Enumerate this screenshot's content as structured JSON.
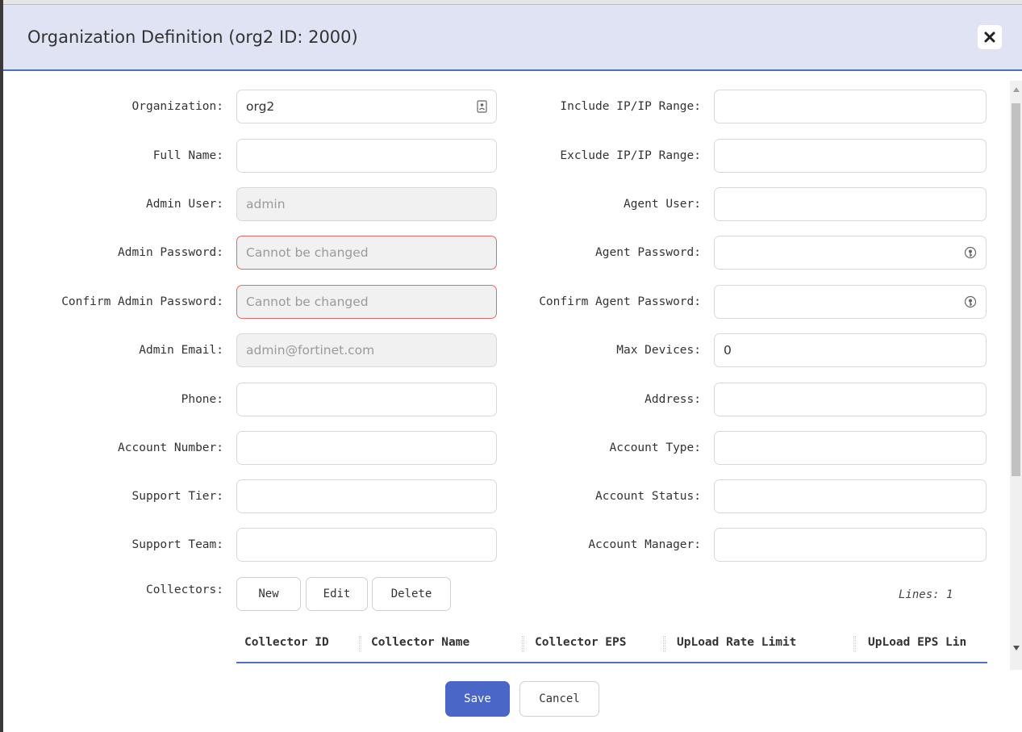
{
  "dialog": {
    "title": "Organization Definition (org2 ID: 2000)",
    "close_icon": "close-icon"
  },
  "left_fields": [
    {
      "label": "Organization:",
      "value": "org2",
      "placeholder": "",
      "state": "normal",
      "icon": "contact-card-icon"
    },
    {
      "label": "Full Name:",
      "value": "",
      "placeholder": "",
      "state": "normal"
    },
    {
      "label": "Admin User:",
      "value": "admin",
      "placeholder": "",
      "state": "disabled"
    },
    {
      "label": "Admin Password:",
      "value": "",
      "placeholder": "Cannot be changed",
      "state": "error"
    },
    {
      "label": "Confirm Admin Password:",
      "value": "",
      "placeholder": "Cannot be changed",
      "state": "error"
    },
    {
      "label": "Admin Email:",
      "value": "admin@fortinet.com",
      "placeholder": "",
      "state": "disabled"
    },
    {
      "label": "Phone:",
      "value": "",
      "placeholder": "",
      "state": "normal"
    },
    {
      "label": "Account Number:",
      "value": "",
      "placeholder": "",
      "state": "normal"
    },
    {
      "label": "Support Tier:",
      "value": "",
      "placeholder": "",
      "state": "normal"
    },
    {
      "label": "Support Team:",
      "value": "",
      "placeholder": "",
      "state": "normal"
    }
  ],
  "right_fields": [
    {
      "label": "Include IP/IP Range:",
      "value": "",
      "placeholder": "",
      "state": "normal"
    },
    {
      "label": "Exclude IP/IP Range:",
      "value": "",
      "placeholder": "",
      "state": "normal"
    },
    {
      "label": "Agent User:",
      "value": "",
      "placeholder": "",
      "state": "normal"
    },
    {
      "label": "Agent Password:",
      "value": "",
      "placeholder": "",
      "state": "normal",
      "icon": "password-key-icon"
    },
    {
      "label": "Confirm Agent Password:",
      "value": "",
      "placeholder": "",
      "state": "normal",
      "icon": "password-key-icon"
    },
    {
      "label": "Max Devices:",
      "value": "0",
      "placeholder": "",
      "state": "normal"
    },
    {
      "label": "Address:",
      "value": "",
      "placeholder": "",
      "state": "normal"
    },
    {
      "label": "Account Type:",
      "value": "",
      "placeholder": "",
      "state": "normal"
    },
    {
      "label": "Account Status:",
      "value": "",
      "placeholder": "",
      "state": "normal"
    },
    {
      "label": "Account Manager:",
      "value": "",
      "placeholder": "",
      "state": "normal"
    }
  ],
  "collectors": {
    "label": "Collectors:",
    "buttons": {
      "new": "New",
      "edit": "Edit",
      "delete": "Delete"
    },
    "lines": "Lines: 1",
    "columns": [
      "Collector ID",
      "Collector Name",
      "Collector EPS",
      "UpLoad Rate Limit",
      "UpLoad EPS Lin"
    ]
  },
  "footer": {
    "save": "Save",
    "cancel": "Cancel"
  },
  "colors": {
    "header_bg": "#dfe3f3",
    "accent": "#4a66c6",
    "error_border": "#e06a6a"
  }
}
